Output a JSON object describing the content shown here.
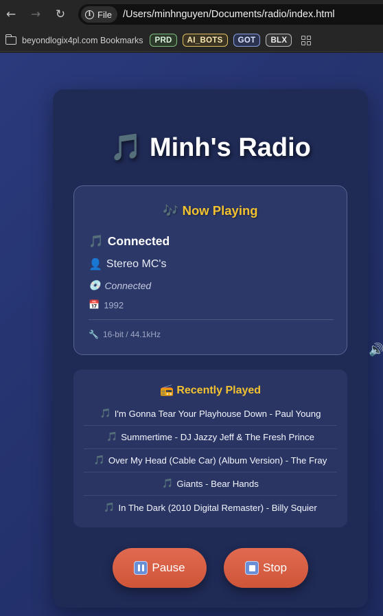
{
  "browser": {
    "site_chip": "File",
    "url": "/Users/minhnguyen/Documents/radio/index.html",
    "bookmarks": {
      "folder": "beyondlogix4pl.com Bookmarks",
      "chips": [
        "PRD",
        "AI_BOTS",
        "GOT",
        "BLX"
      ]
    }
  },
  "app": {
    "title": "🎵 Minh's Radio",
    "now_playing": {
      "heading": "🎶 Now Playing",
      "track": "Connected",
      "artist": "Stereo MC's",
      "album": "Connected",
      "year": "1992",
      "quality": "16-bit / 44.1kHz"
    },
    "recently_played": {
      "heading": "📻 Recently Played",
      "items": [
        "I'm Gonna Tear Your Playhouse Down - Paul Young",
        "Summertime - DJ Jazzy Jeff & The Fresh Prince",
        "Over My Head (Cable Car) (Album Version) - The Fray",
        "Giants - Bear Hands",
        "In The Dark (2010 Digital Remaster) - Billy Squier"
      ]
    },
    "controls": {
      "pause_label": "Pause",
      "stop_label": "Stop"
    }
  },
  "colors": {
    "accent": "#f2c230",
    "button": "#d95d42",
    "card": "#1f2a55",
    "background": "#2a3a7c"
  }
}
